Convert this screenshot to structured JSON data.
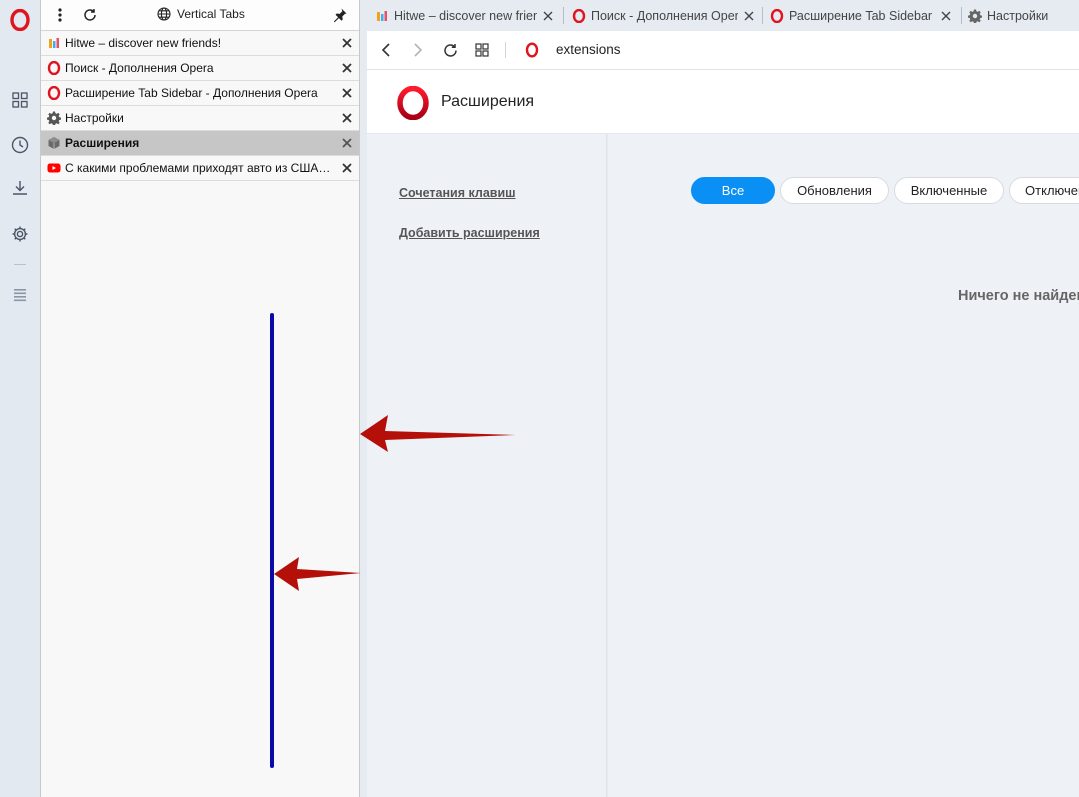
{
  "sidebar": {
    "items": [
      {
        "name": "opera-logo",
        "icon": "opera-icon"
      },
      {
        "name": "speed-dial",
        "icon": "grid-icon"
      },
      {
        "name": "history",
        "icon": "clock-icon"
      },
      {
        "name": "downloads",
        "icon": "download-icon"
      },
      {
        "name": "settings",
        "icon": "gear-icon"
      },
      {
        "name": "sidebar-menu",
        "icon": "list-icon"
      }
    ]
  },
  "vertical_tabs": {
    "title": "Vertical Tabs",
    "tabs": [
      {
        "label": "Hitwe – discover new friends!",
        "icon": "hitwe-icon",
        "active": false
      },
      {
        "label": "Поиск - Дополнения Opera",
        "icon": "opera-icon",
        "active": false
      },
      {
        "label": "Расширение Tab Sidebar - Дополнения Opera",
        "icon": "opera-icon",
        "active": false
      },
      {
        "label": "Настройки",
        "icon": "gear-icon",
        "active": false
      },
      {
        "label": "Расширения",
        "icon": "cube-icon",
        "active": true
      },
      {
        "label": "С какими проблемами приходят авто из США. Не покупай, пока не посмотришь!",
        "icon": "youtube-icon",
        "active": false
      }
    ]
  },
  "tab_strip": {
    "tabs": [
      {
        "label": "Hitwe – discover new friends!",
        "icon": "hitwe-icon"
      },
      {
        "label": "Поиск - Дополнения Opera",
        "icon": "opera-icon"
      },
      {
        "label": "Расширение Tab Sidebar - Дополнения Opera",
        "icon": "opera-icon"
      },
      {
        "label": "Настройки",
        "icon": "gear-icon"
      }
    ]
  },
  "address_bar": {
    "url": "extensions"
  },
  "page": {
    "title": "Расширения",
    "links": [
      "Сочетания клавиш",
      "Добавить расширения"
    ],
    "filters": [
      "Все",
      "Обновления",
      "Включенные",
      "Отключенные"
    ],
    "selected_filter": "Все",
    "empty_message": "Ничего не найдено"
  },
  "colors": {
    "opera_red": "#e0141e",
    "filter_selected": "#0a8ff5",
    "annotation_line": "#0a0aa8",
    "annotation_arrow": "#b50f0a"
  }
}
